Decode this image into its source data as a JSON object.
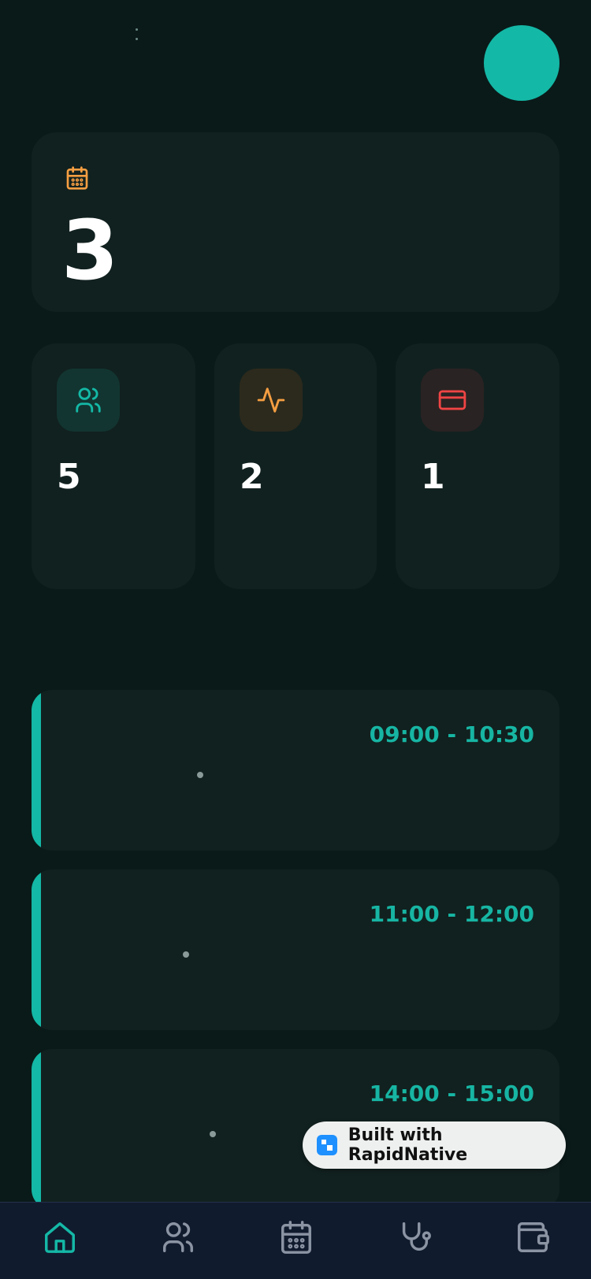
{
  "header": {
    "menu_icon": "kebab-icon",
    "avatar_color": "#14b8a6"
  },
  "hero": {
    "icon": "calendar-icon",
    "icon_color": "#f59e42",
    "count": "3"
  },
  "stats": [
    {
      "icon": "users-icon",
      "icon_color": "#14b8a6",
      "value": "5"
    },
    {
      "icon": "activity-icon",
      "icon_color": "#f59e42",
      "value": "2"
    },
    {
      "icon": "credit-card-icon",
      "icon_color": "#ef4444",
      "value": "1"
    }
  ],
  "appointments": [
    {
      "time": "09:00 - 10:30"
    },
    {
      "time": "11:00 - 12:00"
    },
    {
      "time": "14:00 - 15:00"
    }
  ],
  "badge": {
    "label": "Built with RapidNative"
  },
  "nav": [
    {
      "icon": "home-icon",
      "active": true
    },
    {
      "icon": "users-icon",
      "active": false
    },
    {
      "icon": "calendar-icon",
      "active": false
    },
    {
      "icon": "stethoscope-icon",
      "active": false
    },
    {
      "icon": "wallet-icon",
      "active": false
    }
  ],
  "colors": {
    "accent": "#14b8a6",
    "background": "#0a1a19",
    "card": "#11211f",
    "nav": "#111b2e"
  }
}
